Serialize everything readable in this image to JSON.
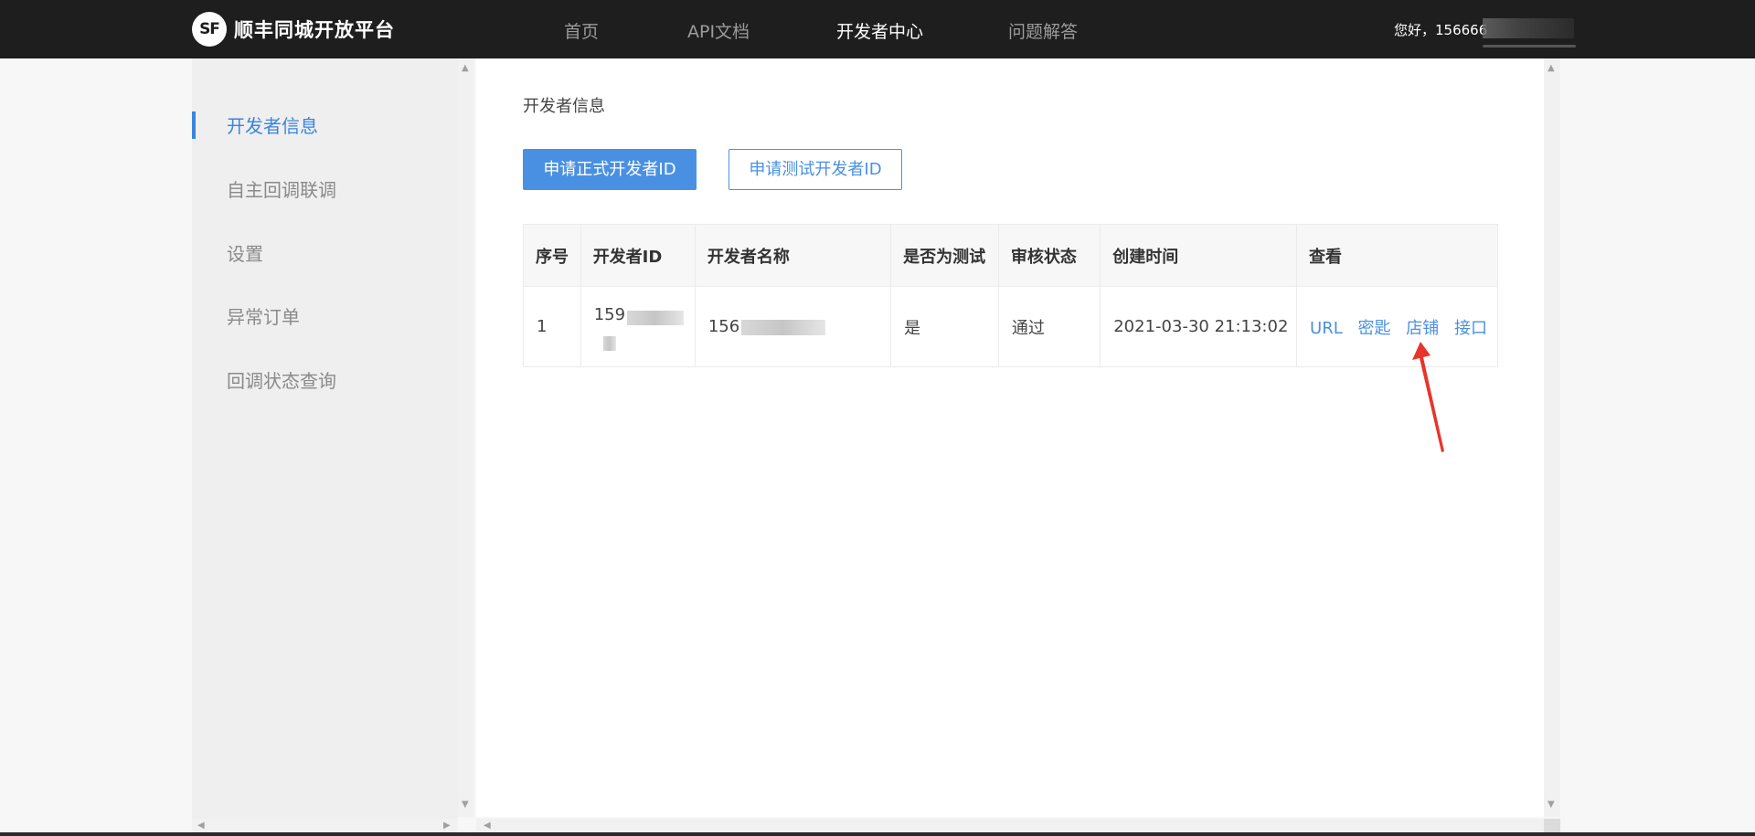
{
  "header": {
    "logo_mark": "SF",
    "logo_text": "顺丰同城开放平台",
    "nav": [
      {
        "label": "首页",
        "active": false
      },
      {
        "label": "API文档",
        "active": false
      },
      {
        "label": "开发者中心",
        "active": true
      },
      {
        "label": "问题解答",
        "active": false
      }
    ],
    "greeting": "您好，156666"
  },
  "sidebar": {
    "items": [
      {
        "label": "开发者信息",
        "active": true
      },
      {
        "label": "自主回调联调",
        "active": false
      },
      {
        "label": "设置",
        "active": false
      },
      {
        "label": "异常订单",
        "active": false
      },
      {
        "label": "回调状态查询",
        "active": false
      }
    ]
  },
  "main": {
    "title": "开发者信息",
    "btn_formal": "申请正式开发者ID",
    "btn_test": "申请测试开发者ID",
    "table": {
      "headers": [
        "序号",
        "开发者ID",
        "开发者名称",
        "是否为测试",
        "审核状态",
        "创建时间",
        "查看"
      ],
      "rows": [
        {
          "index": "1",
          "dev_id": "159",
          "dev_name": "156",
          "is_test": "是",
          "status": "通过",
          "created": "2021-03-30 21:13:02",
          "links": [
            "URL",
            "密匙",
            "店铺",
            "接口"
          ]
        }
      ]
    }
  },
  "colors": {
    "accent": "#4a90e2",
    "annotation": "#e8342a",
    "topbar": "#1e1e1e"
  }
}
